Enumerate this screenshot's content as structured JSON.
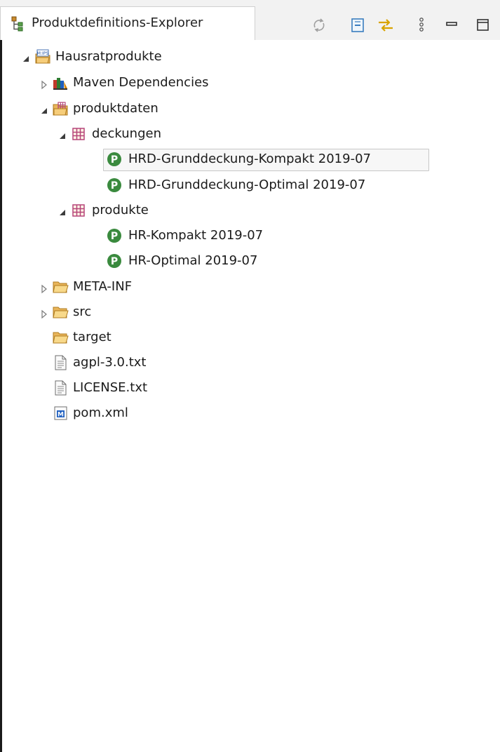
{
  "view": {
    "title": "Produktdefinitions-Explorer",
    "toolbar": [
      {
        "name": "sync-icon"
      },
      {
        "name": "collapse-all-icon"
      },
      {
        "name": "link-with-editor-icon"
      },
      {
        "name": "view-menu-icon"
      },
      {
        "name": "minimize-icon"
      },
      {
        "name": "maximize-icon"
      }
    ]
  },
  "tree": {
    "root": {
      "label": "Hausratprodukte",
      "icon": "ips-project-icon",
      "expanded": true
    },
    "maven": {
      "label": "Maven Dependencies",
      "icon": "library-icon",
      "expanded": false
    },
    "produktdaten": {
      "label": "produktdaten",
      "icon": "ips-folder-icon",
      "expanded": true
    },
    "deckungen": {
      "label": "deckungen",
      "icon": "package-icon",
      "expanded": true
    },
    "d1": {
      "label": "HRD-Grunddeckung-Kompakt 2019-07",
      "icon": "product-icon",
      "selected": true
    },
    "d2": {
      "label": "HRD-Grunddeckung-Optimal 2019-07",
      "icon": "product-icon"
    },
    "produkte": {
      "label": "produkte",
      "icon": "package-icon",
      "expanded": true
    },
    "p1": {
      "label": "HR-Kompakt 2019-07",
      "icon": "product-icon"
    },
    "p2": {
      "label": "HR-Optimal 2019-07",
      "icon": "product-icon"
    },
    "metainf": {
      "label": "META-INF",
      "icon": "folder-icon",
      "expanded": false
    },
    "src": {
      "label": "src",
      "icon": "folder-icon",
      "expanded": false
    },
    "target": {
      "label": "target",
      "icon": "folder-icon"
    },
    "agpl": {
      "label": "agpl-3.0.txt",
      "icon": "text-file-icon"
    },
    "license": {
      "label": "LICENSE.txt",
      "icon": "text-file-icon"
    },
    "pom": {
      "label": "pom.xml",
      "icon": "maven-file-icon"
    }
  },
  "colors": {
    "product_green": "#3a8a3e",
    "folder_yellow": "#e8b84a",
    "package_purple": "#b5457a",
    "selection_border": "#c7c7c7"
  }
}
